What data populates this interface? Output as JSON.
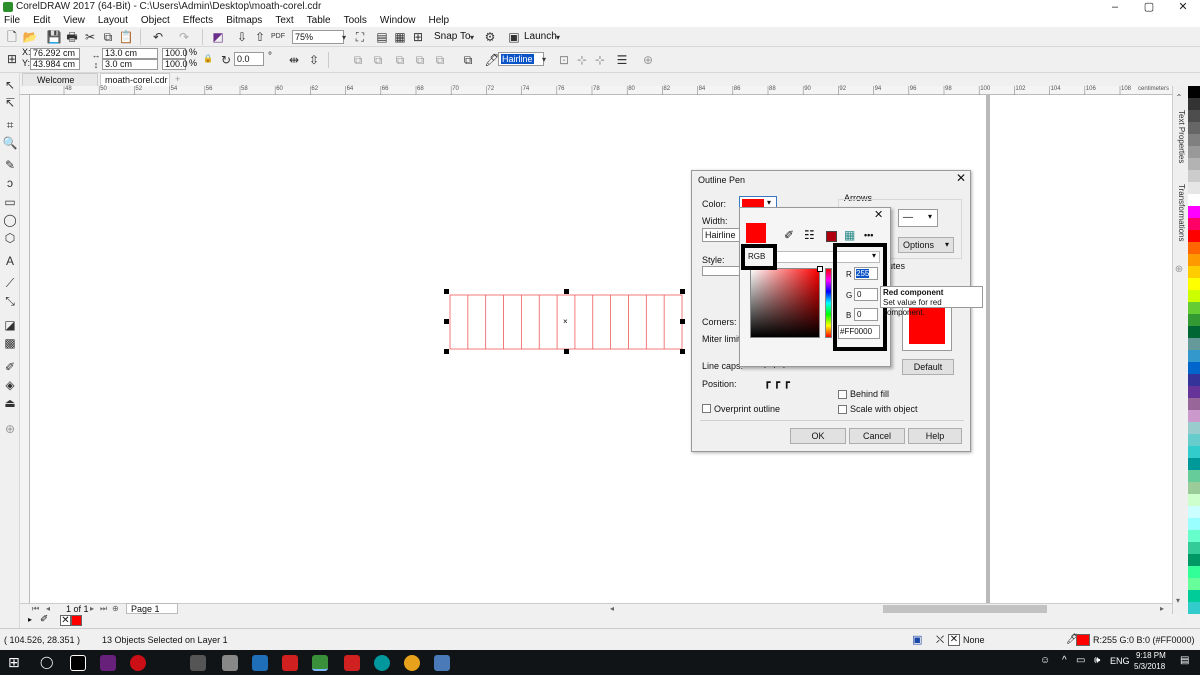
{
  "window": {
    "title": "CorelDRAW 2017 (64-Bit) - C:\\Users\\Admin\\Desktop\\moath-corel.cdr",
    "controls": [
      "–",
      "▢",
      "✕"
    ]
  },
  "menu": [
    "File",
    "Edit",
    "View",
    "Layout",
    "Object",
    "Effects",
    "Bitmaps",
    "Text",
    "Table",
    "Tools",
    "Window",
    "Help"
  ],
  "standard_toolbar": {
    "zoom": "75%",
    "snap_to": "Snap To",
    "launch": "Launch"
  },
  "property_bar": {
    "x": "76.292 cm",
    "y": "43.984 cm",
    "width": "13.0 cm",
    "height": "3.0 cm",
    "scale_x": "100.0",
    "scale_y": "100.0",
    "pct": "%",
    "rotation": "0.0",
    "degree": "°",
    "outline": "Hairline"
  },
  "doc_tabs": [
    "Welcome Screen",
    "moath-corel.cdr",
    "+"
  ],
  "ruler_ticks": [
    "48",
    "50",
    "52",
    "54",
    "56",
    "58",
    "60",
    "62",
    "64",
    "66",
    "68",
    "70",
    "72",
    "74",
    "76",
    "78",
    "80",
    "82",
    "84",
    "86",
    "88",
    "90",
    "92",
    "94",
    "96",
    "98",
    "100",
    "102",
    "104",
    "106",
    "108"
  ],
  "ruler_unit": "centimeters",
  "docker_tabs": [
    "Text Properties",
    "Transformations"
  ],
  "page_nav": {
    "pages": "1 of 1",
    "page_tab": "Page 1"
  },
  "status": {
    "coords": "( 104.526, 28.351 )",
    "selection": "13 Objects Selected on Layer 1",
    "fill": "None",
    "outline": "R:255 G:0 B:0 (#FF0000)"
  },
  "taskbar": {
    "lang": "ENG",
    "time": "9:18 PM",
    "date": "5/3/2018"
  },
  "outline_pen": {
    "title": "Outline Pen",
    "close": "✕",
    "color_label": "Color:",
    "width_label": "Width:",
    "width_value": "Hairline",
    "style_label": "Style:",
    "arrows_label": "Arrows",
    "options_label": "Options",
    "attributes_suffix": "utes",
    "corners_label": "Corners:",
    "miter_label": "Miter limit:",
    "linecaps_label": "Line caps:",
    "position_label": "Position:",
    "overprint": "Overprint outline",
    "behind_fill": "Behind fill",
    "scale_with_object": "Scale with object",
    "default": "Default",
    "ok": "OK",
    "cancel": "Cancel",
    "help": "Help",
    "color_hex": "#FF0000"
  },
  "color_picker": {
    "close": "✕",
    "model": "RGB",
    "r_label": "R",
    "r_value": "255",
    "g_label": "G",
    "g_value": "0",
    "b_label": "B",
    "b_value": "0",
    "hex": "#FF0000",
    "more": "•••"
  },
  "tooltip": {
    "title": "Red component",
    "body": "Set value for red component."
  },
  "palette_colors": [
    "#000000",
    "#333333",
    "#4d4d4d",
    "#666666",
    "#808080",
    "#999999",
    "#b3b3b3",
    "#cccccc",
    "#e6e6e6",
    "#ffffff",
    "#ff00ff",
    "#ff0066",
    "#ff0000",
    "#ff6600",
    "#ff9900",
    "#ffcc00",
    "#ffff00",
    "#ccff00",
    "#66cc33",
    "#339933",
    "#006633",
    "#669999",
    "#3399cc",
    "#0066cc",
    "#333399",
    "#663399",
    "#996699",
    "#cc99cc",
    "#99cccc",
    "#66cccc",
    "#33cccc",
    "#009999",
    "#66cc99",
    "#99cc99",
    "#ccffcc",
    "#ccffff",
    "#99ffff",
    "#66ffcc",
    "#33cc99",
    "#009966",
    "#33ff99",
    "#66ff99",
    "#00cc99",
    "#33cccc"
  ],
  "accent": "#ff0000",
  "highlight_color": "#000000"
}
